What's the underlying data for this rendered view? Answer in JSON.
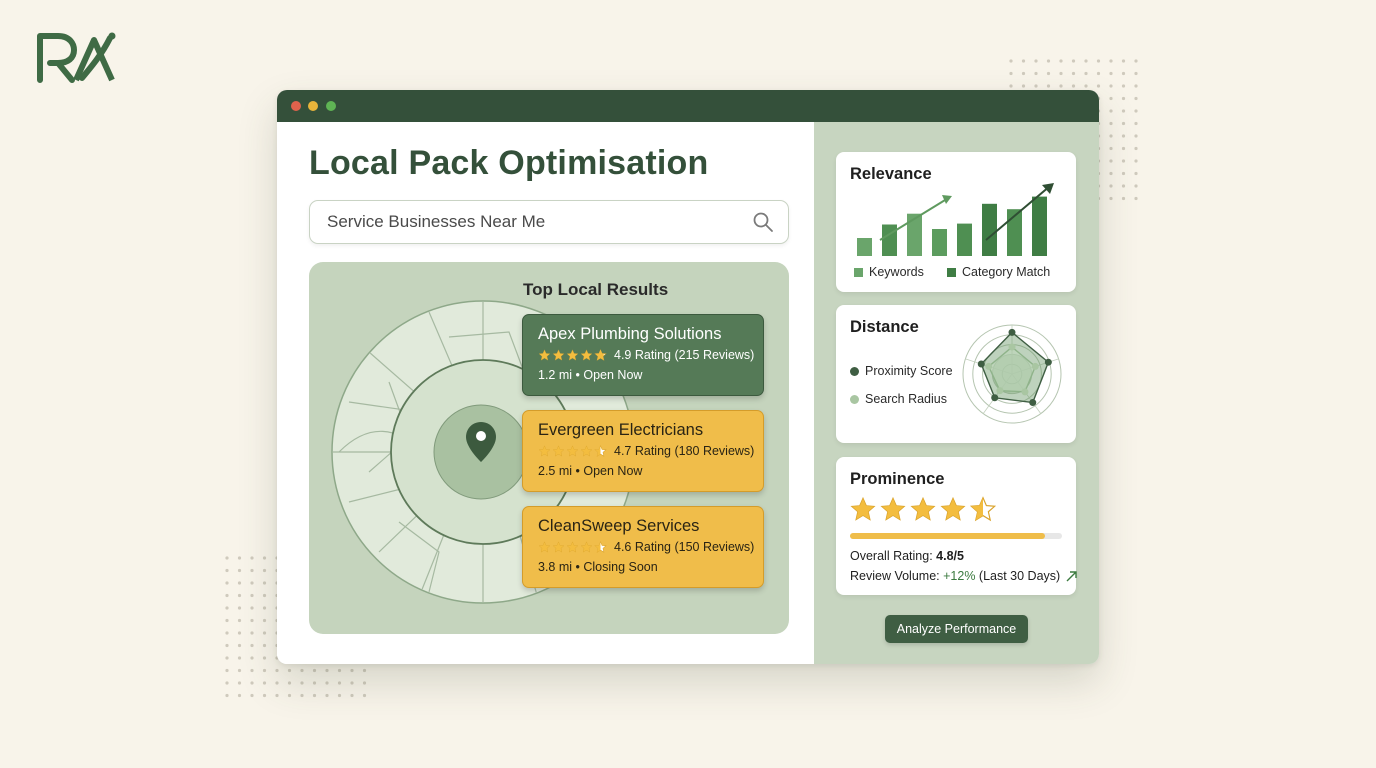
{
  "brand": {
    "logo_text": "RA"
  },
  "colors": {
    "dark_green": "#34503a",
    "mid_green": "#557a57",
    "light_green": "#c7d5c0",
    "amber": "#f0bd4a",
    "background": "#f8f4ea"
  },
  "window": {
    "controls": [
      "close",
      "minimize",
      "maximize"
    ],
    "control_colors": [
      "#e0624c",
      "#e8b53a",
      "#5fb454"
    ]
  },
  "page": {
    "title": "Local Pack Optimisation",
    "search_value": "Service Businesses Near Me",
    "search_icon": "search-icon"
  },
  "map": {
    "heading": "Top Local Results",
    "pin_icon": "map-pin-icon",
    "results": [
      {
        "name": "Apex Plumbing Solutions",
        "rating": 4.9,
        "rating_text": "4.9 Rating (215 Reviews)",
        "meta": "1.2 mi • Open Now",
        "style": "primary"
      },
      {
        "name": "Evergreen Electricians",
        "rating": 4.7,
        "rating_text": "4.7 Rating (180 Reviews)",
        "meta": "2.5 mi • Open Now",
        "style": "secondary"
      },
      {
        "name": "CleanSweep Services",
        "rating": 4.6,
        "rating_text": "4.6 Rating (150 Reviews)",
        "meta": "3.8 mi • Closing Soon",
        "style": "secondary"
      }
    ]
  },
  "metrics": {
    "relevance": {
      "title": "Relevance",
      "legend": [
        {
          "label": "Keywords",
          "color": "#6aa56b"
        },
        {
          "label": "Category Match",
          "color": "#3f7d44"
        }
      ]
    },
    "distance": {
      "title": "Distance",
      "legend": [
        {
          "label": "Proximity Score",
          "color": "#3f5e43"
        },
        {
          "label": "Search Radius",
          "color": "#a9c6a2"
        }
      ]
    },
    "prominence": {
      "title": "Prominence",
      "stars": 4.5,
      "progress": 0.92,
      "rating_label": "Overall Rating: ",
      "rating_value": "4.8/5",
      "volume_label": "Review Volume: ",
      "volume_change": "+12%",
      "volume_period": " (Last 30 Days)",
      "trend_icon": "trend-up-arrow-icon"
    }
  },
  "actions": {
    "analyze_label": "Analyze Performance"
  },
  "chart_data": [
    {
      "type": "bar",
      "categories": [
        "",
        "",
        "",
        "",
        "",
        "",
        "",
        ""
      ],
      "series": [
        {
          "name": "Keywords",
          "values": [
            2,
            3.5,
            4.7,
            3,
            3.6,
            5.8,
            5.2,
            6.6
          ]
        },
        {
          "name": "Category Match",
          "values": [
            2,
            3.5,
            4.7,
            3,
            3.6,
            5.8,
            5.2,
            6.6
          ]
        }
      ],
      "title": "Relevance",
      "xlabel": "",
      "ylabel": "",
      "ylim": [
        0,
        8
      ]
    },
    {
      "type": "radar",
      "axes": 5,
      "series": [
        {
          "name": "Proximity Score",
          "values": [
            0.85,
            0.78,
            0.72,
            0.6,
            0.66
          ]
        },
        {
          "name": "Search Radius",
          "values": [
            0.55,
            0.5,
            0.45,
            0.42,
            0.5
          ]
        }
      ],
      "title": "Distance"
    }
  ]
}
